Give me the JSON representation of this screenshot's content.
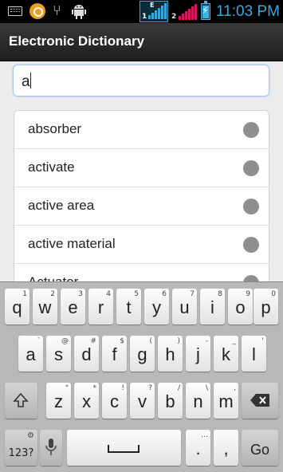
{
  "status": {
    "time": "11:03 PM",
    "sim1": "1",
    "sim1_net": "E",
    "sim2": "2",
    "icons": [
      "keyboard-icon",
      "orange-app-icon",
      "usb-icon",
      "android-icon",
      "signal-sim1-icon",
      "signal-sim2-icon",
      "battery-charging-icon"
    ],
    "colors": {
      "time": "#39a9e0",
      "sim1_bars": "#3aa6d8",
      "sim2_bars": "#d0195a"
    }
  },
  "app": {
    "title": "Electronic Dictionary"
  },
  "search": {
    "value": "a"
  },
  "results": [
    {
      "label": "absorber"
    },
    {
      "label": "activate"
    },
    {
      "label": "active area"
    },
    {
      "label": "active material"
    },
    {
      "label": "Actuator"
    }
  ],
  "keyboard": {
    "row1": [
      {
        "main": "q",
        "sub": "1"
      },
      {
        "main": "w",
        "sub": "2"
      },
      {
        "main": "e",
        "sub": "3"
      },
      {
        "main": "r",
        "sub": "4"
      },
      {
        "main": "t",
        "sub": "5"
      },
      {
        "main": "y",
        "sub": "6"
      },
      {
        "main": "u",
        "sub": "7"
      },
      {
        "main": "i",
        "sub": "8"
      },
      {
        "main": "o",
        "sub": "9"
      },
      {
        "main": "p",
        "sub": "0"
      }
    ],
    "row2": [
      {
        "main": "a",
        "sub": "`"
      },
      {
        "main": "s",
        "sub": "@"
      },
      {
        "main": "d",
        "sub": "#"
      },
      {
        "main": "f",
        "sub": "$"
      },
      {
        "main": "g",
        "sub": "("
      },
      {
        "main": "h",
        "sub": ")"
      },
      {
        "main": "j",
        "sub": "-"
      },
      {
        "main": "k",
        "sub": "_"
      },
      {
        "main": "l",
        "sub": "'"
      }
    ],
    "row3": [
      {
        "main": "z",
        "sub": "\""
      },
      {
        "main": "x",
        "sub": "*"
      },
      {
        "main": "c",
        "sub": "!"
      },
      {
        "main": "v",
        "sub": "?"
      },
      {
        "main": "b",
        "sub": "/"
      },
      {
        "main": "n",
        "sub": "\\"
      },
      {
        "main": "m",
        "sub": ","
      }
    ],
    "symbols_label": "123?",
    "period": ".",
    "period_sub": "…",
    "comma": ",",
    "go_label": "Go",
    "shift_icon": "shift-icon",
    "backspace_icon": "backspace-icon",
    "mic_icon": "microphone-icon",
    "space_icon": "spacebar-icon",
    "settings_icon": "gear-icon"
  }
}
